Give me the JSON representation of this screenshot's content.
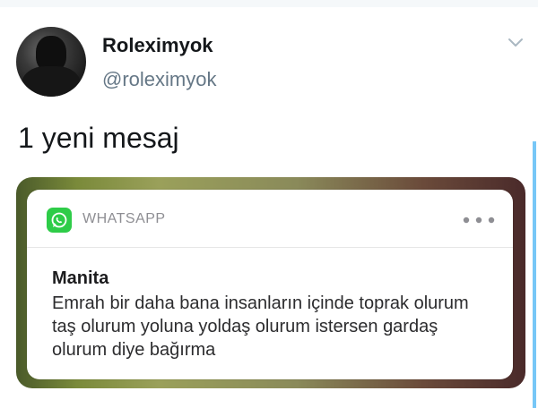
{
  "tweet": {
    "display_name": "Roleximyok",
    "handle": "@roleximyok",
    "text": "1 yeni mesaj"
  },
  "notification": {
    "app_name": "WHATSAPP",
    "sender": "Manita",
    "message": "Emrah bir daha bana insanların içinde toprak olurum taş olurum yoluna yoldaş olurum istersen gardaş olurum diye bağırma"
  },
  "colors": {
    "accent": "#1da1f2",
    "whatsapp_green": "#2ecc48",
    "handle_gray": "#657786"
  },
  "icons": {
    "caret": "chevron-down-icon",
    "app": "whatsapp-icon",
    "more": "ellipsis-icon"
  }
}
